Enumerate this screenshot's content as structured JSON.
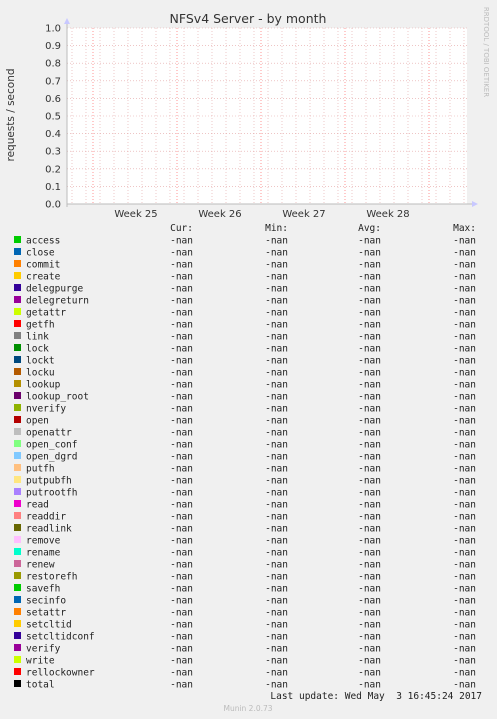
{
  "chart_data": {
    "type": "line",
    "title": "NFSv4 Server - by month",
    "ylabel": "requests / second",
    "side_label": "RRDTOOL / TOBI OETIKER",
    "ylim": [
      0,
      1.0
    ],
    "y_ticks": [
      "0.0",
      "0.1",
      "0.2",
      "0.3",
      "0.4",
      "0.5",
      "0.6",
      "0.7",
      "0.8",
      "0.9",
      "1.0"
    ],
    "x_ticks": [
      "Week 25",
      "Week 26",
      "Week 27",
      "Week 28"
    ],
    "grid": true,
    "legend_headers": [
      "Cur:",
      "Min:",
      "Avg:",
      "Max:"
    ],
    "series": [
      {
        "name": "access",
        "color": "#00cc00",
        "cur": "-nan",
        "min": "-nan",
        "avg": "-nan",
        "max": "-nan"
      },
      {
        "name": "close",
        "color": "#0066b3",
        "cur": "-nan",
        "min": "-nan",
        "avg": "-nan",
        "max": "-nan"
      },
      {
        "name": "commit",
        "color": "#ff8000",
        "cur": "-nan",
        "min": "-nan",
        "avg": "-nan",
        "max": "-nan"
      },
      {
        "name": "create",
        "color": "#ffcc00",
        "cur": "-nan",
        "min": "-nan",
        "avg": "-nan",
        "max": "-nan"
      },
      {
        "name": "delegpurge",
        "color": "#330099",
        "cur": "-nan",
        "min": "-nan",
        "avg": "-nan",
        "max": "-nan"
      },
      {
        "name": "delegreturn",
        "color": "#990099",
        "cur": "-nan",
        "min": "-nan",
        "avg": "-nan",
        "max": "-nan"
      },
      {
        "name": "getattr",
        "color": "#ccff00",
        "cur": "-nan",
        "min": "-nan",
        "avg": "-nan",
        "max": "-nan"
      },
      {
        "name": "getfh",
        "color": "#ff0000",
        "cur": "-nan",
        "min": "-nan",
        "avg": "-nan",
        "max": "-nan"
      },
      {
        "name": "link",
        "color": "#808080",
        "cur": "-nan",
        "min": "-nan",
        "avg": "-nan",
        "max": "-nan"
      },
      {
        "name": "lock",
        "color": "#008f00",
        "cur": "-nan",
        "min": "-nan",
        "avg": "-nan",
        "max": "-nan"
      },
      {
        "name": "lockt",
        "color": "#00487d",
        "cur": "-nan",
        "min": "-nan",
        "avg": "-nan",
        "max": "-nan"
      },
      {
        "name": "locku",
        "color": "#b35a00",
        "cur": "-nan",
        "min": "-nan",
        "avg": "-nan",
        "max": "-nan"
      },
      {
        "name": "lookup",
        "color": "#b38f00",
        "cur": "-nan",
        "min": "-nan",
        "avg": "-nan",
        "max": "-nan"
      },
      {
        "name": "lookup_root",
        "color": "#6b006b",
        "cur": "-nan",
        "min": "-nan",
        "avg": "-nan",
        "max": "-nan"
      },
      {
        "name": "nverify",
        "color": "#8fb300",
        "cur": "-nan",
        "min": "-nan",
        "avg": "-nan",
        "max": "-nan"
      },
      {
        "name": "open",
        "color": "#b30000",
        "cur": "-nan",
        "min": "-nan",
        "avg": "-nan",
        "max": "-nan"
      },
      {
        "name": "openattr",
        "color": "#bebebe",
        "cur": "-nan",
        "min": "-nan",
        "avg": "-nan",
        "max": "-nan"
      },
      {
        "name": "open_conf",
        "color": "#80ff80",
        "cur": "-nan",
        "min": "-nan",
        "avg": "-nan",
        "max": "-nan"
      },
      {
        "name": "open_dgrd",
        "color": "#80c9ff",
        "cur": "-nan",
        "min": "-nan",
        "avg": "-nan",
        "max": "-nan"
      },
      {
        "name": "putfh",
        "color": "#ffc080",
        "cur": "-nan",
        "min": "-nan",
        "avg": "-nan",
        "max": "-nan"
      },
      {
        "name": "putpubfh",
        "color": "#ffe680",
        "cur": "-nan",
        "min": "-nan",
        "avg": "-nan",
        "max": "-nan"
      },
      {
        "name": "putrootfh",
        "color": "#aa80ff",
        "cur": "-nan",
        "min": "-nan",
        "avg": "-nan",
        "max": "-nan"
      },
      {
        "name": "read",
        "color": "#ee00cc",
        "cur": "-nan",
        "min": "-nan",
        "avg": "-nan",
        "max": "-nan"
      },
      {
        "name": "readdir",
        "color": "#ff8080",
        "cur": "-nan",
        "min": "-nan",
        "avg": "-nan",
        "max": "-nan"
      },
      {
        "name": "readlink",
        "color": "#666600",
        "cur": "-nan",
        "min": "-nan",
        "avg": "-nan",
        "max": "-nan"
      },
      {
        "name": "remove",
        "color": "#ffbfff",
        "cur": "-nan",
        "min": "-nan",
        "avg": "-nan",
        "max": "-nan"
      },
      {
        "name": "rename",
        "color": "#00ffcc",
        "cur": "-nan",
        "min": "-nan",
        "avg": "-nan",
        "max": "-nan"
      },
      {
        "name": "renew",
        "color": "#cc6699",
        "cur": "-nan",
        "min": "-nan",
        "avg": "-nan",
        "max": "-nan"
      },
      {
        "name": "restorefh",
        "color": "#999900",
        "cur": "-nan",
        "min": "-nan",
        "avg": "-nan",
        "max": "-nan"
      },
      {
        "name": "savefh",
        "color": "#00cc00",
        "cur": "-nan",
        "min": "-nan",
        "avg": "-nan",
        "max": "-nan"
      },
      {
        "name": "secinfo",
        "color": "#0066b3",
        "cur": "-nan",
        "min": "-nan",
        "avg": "-nan",
        "max": "-nan"
      },
      {
        "name": "setattr",
        "color": "#ff8000",
        "cur": "-nan",
        "min": "-nan",
        "avg": "-nan",
        "max": "-nan"
      },
      {
        "name": "setcltid",
        "color": "#ffcc00",
        "cur": "-nan",
        "min": "-nan",
        "avg": "-nan",
        "max": "-nan"
      },
      {
        "name": "setcltidconf",
        "color": "#330099",
        "cur": "-nan",
        "min": "-nan",
        "avg": "-nan",
        "max": "-nan"
      },
      {
        "name": "verify",
        "color": "#990099",
        "cur": "-nan",
        "min": "-nan",
        "avg": "-nan",
        "max": "-nan"
      },
      {
        "name": "write",
        "color": "#ccff00",
        "cur": "-nan",
        "min": "-nan",
        "avg": "-nan",
        "max": "-nan"
      },
      {
        "name": "rellockowner",
        "color": "#ff0000",
        "cur": "-nan",
        "min": "-nan",
        "avg": "-nan",
        "max": "-nan"
      },
      {
        "name": "total",
        "color": "#000000",
        "cur": "-nan",
        "min": "-nan",
        "avg": "-nan",
        "max": "-nan"
      }
    ],
    "last_update": "Last update: Wed May  3 16:45:24 2017",
    "footer": "Munin 2.0.73"
  }
}
